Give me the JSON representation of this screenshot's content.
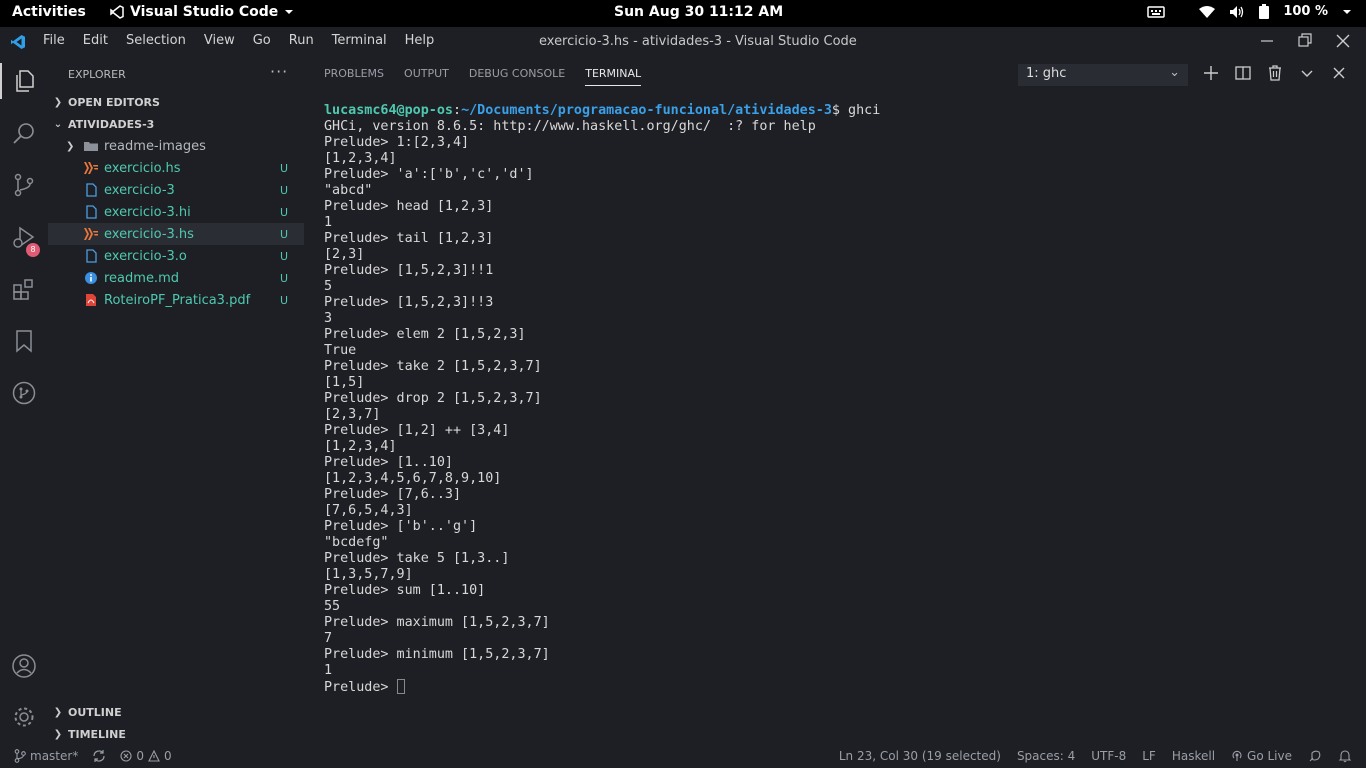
{
  "gnome": {
    "activities": "Activities",
    "app_name": "Visual Studio Code",
    "clock": "Sun Aug 30  11:12 AM",
    "battery": "100 %"
  },
  "titlebar": {
    "menu": [
      "File",
      "Edit",
      "Selection",
      "View",
      "Go",
      "Run",
      "Terminal",
      "Help"
    ],
    "title": "exercicio-3.hs - atividades-3 - Visual Studio Code"
  },
  "activity": {
    "scm_badge": "8"
  },
  "explorer": {
    "title": "EXPLORER",
    "more": "···",
    "open_editors": "OPEN EDITORS",
    "folder": "ATIVIDADES-3",
    "items": [
      {
        "label": "readme-images",
        "type": "folder",
        "status": ""
      },
      {
        "label": "exercicio.hs",
        "type": "haskell",
        "status": "U"
      },
      {
        "label": "exercicio-3",
        "type": "file",
        "status": "U"
      },
      {
        "label": "exercicio-3.hi",
        "type": "file",
        "status": "U"
      },
      {
        "label": "exercicio-3.hs",
        "type": "haskell",
        "status": "U"
      },
      {
        "label": "exercicio-3.o",
        "type": "file",
        "status": "U"
      },
      {
        "label": "readme.md",
        "type": "info",
        "status": "U"
      },
      {
        "label": "RoteiroPF_Pratica3.pdf",
        "type": "pdf",
        "status": "U"
      }
    ],
    "outline": "OUTLINE",
    "timeline": "TIMELINE"
  },
  "panel": {
    "tabs": [
      "PROBLEMS",
      "OUTPUT",
      "DEBUG CONSOLE",
      "TERMINAL"
    ],
    "terminal_select": "1: ghc",
    "prompt_user": "lucasmc64@pop-os",
    "prompt_path": "~/Documents/programacao-funcional/atividades-3",
    "prompt_cmd": "$ ghci",
    "lines": [
      "GHCi, version 8.6.5: http://www.haskell.org/ghc/  :? for help",
      "Prelude> 1:[2,3,4]",
      "[1,2,3,4]",
      "Prelude> 'a':['b','c','d']",
      "\"abcd\"",
      "Prelude> head [1,2,3]",
      "1",
      "Prelude> tail [1,2,3]",
      "[2,3]",
      "Prelude> [1,5,2,3]!!1",
      "5",
      "Prelude> [1,5,2,3]!!3",
      "3",
      "Prelude> elem 2 [1,5,2,3]",
      "True",
      "Prelude> take 2 [1,5,2,3,7]",
      "[1,5]",
      "Prelude> drop 2 [1,5,2,3,7]",
      "[2,3,7]",
      "Prelude> [1,2] ++ [3,4]",
      "[1,2,3,4]",
      "Prelude> [1..10]",
      "[1,2,3,4,5,6,7,8,9,10]",
      "Prelude> [7,6..3]",
      "[7,6,5,4,3]",
      "Prelude> ['b'..'g']",
      "\"bcdefg\"",
      "Prelude> take 5 [1,3..]",
      "[1,3,5,7,9]",
      "Prelude> sum [1..10]",
      "55",
      "Prelude> maximum [1,5,2,3,7]",
      "7",
      "Prelude> minimum [1,5,2,3,7]",
      "1"
    ],
    "last_prompt": "Prelude> "
  },
  "status": {
    "branch": "master*",
    "errors": "0",
    "warnings": "0",
    "position": "Ln 23, Col 30 (19 selected)",
    "spaces": "Spaces: 4",
    "encoding": "UTF-8",
    "eol": "LF",
    "language": "Haskell",
    "golive": "Go Live"
  }
}
